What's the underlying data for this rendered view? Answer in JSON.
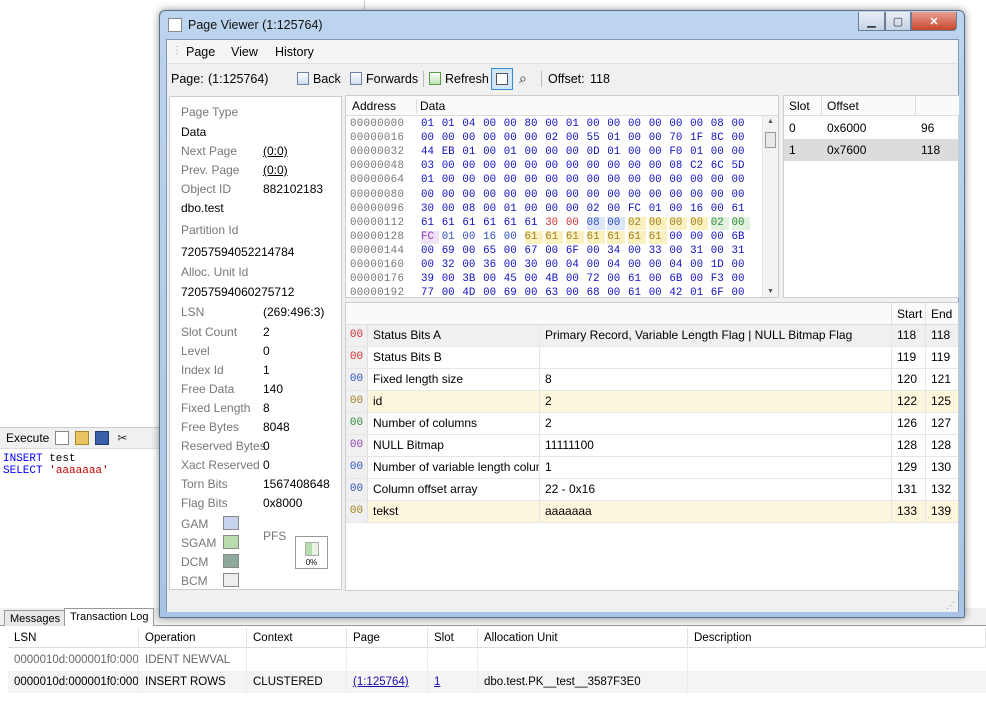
{
  "background": {
    "exec_label": "Execute",
    "sql_lines": [
      {
        "kw": "INSERT",
        "rest": " test",
        "str": ""
      },
      {
        "kw": "SELECT",
        "rest": " ",
        "str": "'aaaaaaa'"
      }
    ],
    "tabs": {
      "messages": "Messages",
      "transaction_log": "Transaction Log"
    },
    "log_columns": [
      "LSN",
      "Operation",
      "Context",
      "Page",
      "Slot",
      "Allocation Unit",
      "Description"
    ],
    "log_rows": [
      {
        "lsn": "0000010d:000001f0:0001",
        "op": "IDENT NEWVAL",
        "ctx": "",
        "page": "",
        "slot": "",
        "alloc": "",
        "desc": ""
      },
      {
        "lsn": "0000010d:000001f0:0003",
        "op": "INSERT ROWS",
        "ctx": "CLUSTERED",
        "page": "(1:125764)",
        "slot": "1",
        "alloc": "dbo.test.PK__test__3587F3E0",
        "desc": ""
      }
    ]
  },
  "window": {
    "title": "Page Viewer (1:125764)",
    "menu": [
      "Page",
      "View",
      "History"
    ],
    "toolbar": {
      "page_label": "Page:",
      "page_value": "(1:125764)",
      "back": "Back",
      "forwards": "Forwards",
      "refresh": "Refresh",
      "offset_label": "Offset:",
      "offset_value": "118"
    }
  },
  "info": {
    "page_type_label": "Page Type",
    "page_type": "Data",
    "next_page_label": "Next Page",
    "next_page": "(0:0)",
    "prev_page_label": "Prev. Page",
    "prev_page": "(0:0)",
    "object_id_label": "Object ID",
    "object_id": "882102183",
    "object_name": "dbo.test",
    "partition_id_label": "Partition Id",
    "partition_id": "72057594052214784",
    "alloc_unit_label": "Alloc. Unit Id",
    "alloc_unit_id": "72057594060275712",
    "lsn_label": "LSN",
    "lsn": "(269:496:3)",
    "slot_count_label": "Slot Count",
    "slot_count": "2",
    "level_label": "Level",
    "level": "0",
    "index_id_label": "Index Id",
    "index_id": "1",
    "free_data_label": "Free Data",
    "free_data": "140",
    "fixed_length_label": "Fixed Length",
    "fixed_length": "8",
    "free_bytes_label": "Free Bytes",
    "free_bytes": "8048",
    "reserved_bytes_label": "Reserved Bytes",
    "reserved_bytes": "0",
    "xact_reserved_label": "Xact Reserved",
    "xact_reserved": "0",
    "torn_bits_label": "Torn Bits",
    "torn_bits": "1567408648",
    "flag_bits_label": "Flag Bits",
    "flag_bits": "0x8000",
    "gam_label": "GAM",
    "sgam_label": "SGAM",
    "dcm_label": "DCM",
    "bcm_label": "BCM",
    "pfs_label": "PFS",
    "pfs_pct": "0%",
    "colors": {
      "gam": "#c8d4ee",
      "sgam": "#b9dcae",
      "dcm": "#8fa89c",
      "bcm": "#eeeeee"
    }
  },
  "hex": {
    "address_header": "Address",
    "data_header": "Data",
    "addresses": [
      "00000000",
      "00000016",
      "00000032",
      "00000048",
      "00000064",
      "00000080",
      "00000096",
      "00000112",
      "00000128",
      "00000144",
      "00000160",
      "00000176",
      "00000192"
    ],
    "rows": [
      "01 01 04 00 00 80 00 01 00 00 00 00 00 00 08 00",
      "00 00 00 00 00 00 02 00 55 01 00 00 70 1F 8C 00",
      "44 EB 01 00 01 00 00 00 0D 01 00 00 F0 01 00 00",
      "03 00 00 00 00 00 00 00 00 00 00 00 08 C2 6C 5D",
      "01 00 00 00 00 00 00 00 00 00 00 00 00 00 00 00",
      "00 00 00 00 00 00 00 00 00 00 00 00 00 00 00 00",
      "30 00 08 00 01 00 00 00 02 00 FC 01 00 16 00 61",
      "61 61 61 61 61 61 30 00 08 00 02 00 00 00 02 00",
      "FC 01 00 16 00 61 61 61 61 61 61 61 00 00 00 6B",
      "00 69 00 65 00 67 00 6F 00 34 00 33 00 31 00 31",
      "00 32 00 36 00 30 00 04 00 04 00 00 04 00 1D 00",
      "39 00 3B 00 45 00 4B 00 72 00 61 00 6B 00 F3 00",
      "77 00 4D 00 69 00 63 00 68 00 61 00 42 01 6F 00"
    ]
  },
  "slots": {
    "headers": [
      "Slot",
      "Offset"
    ],
    "rows": [
      {
        "slot": "0",
        "hex": "0x6000",
        "dec": "96"
      },
      {
        "slot": "1",
        "hex": "0x7600",
        "dec": "118"
      }
    ]
  },
  "fields": {
    "headers": {
      "start": "Start",
      "end": "End"
    },
    "rows": [
      {
        "code": "00",
        "code_color": "#d03030",
        "name": "Status Bits A",
        "value": "Primary Record, Variable Length Flag | NULL Bitmap Flag",
        "start": "118",
        "end": "118",
        "bg": "#f0f0f0"
      },
      {
        "code": "00",
        "code_color": "#d03030",
        "name": "Status Bits B",
        "value": "",
        "start": "119",
        "end": "119",
        "bg": "#ffffff"
      },
      {
        "code": "00",
        "code_color": "#3050c0",
        "name": "Fixed length size",
        "value": "8",
        "start": "120",
        "end": "121",
        "bg": "#ffffff"
      },
      {
        "code": "00",
        "code_color": "#a08020",
        "name": "id",
        "value": "2",
        "start": "122",
        "end": "125",
        "bg": "#fbf6dc"
      },
      {
        "code": "00",
        "code_color": "#2f8a3a",
        "name": "Number of columns",
        "value": "2",
        "start": "126",
        "end": "127",
        "bg": "#ffffff"
      },
      {
        "code": "00",
        "code_color": "#9040b0",
        "name": "NULL Bitmap",
        "value": "11111100",
        "start": "128",
        "end": "128",
        "bg": "#ffffff"
      },
      {
        "code": "00",
        "code_color": "#3050c0",
        "name": "Number of variable length columns",
        "value": "1",
        "start": "129",
        "end": "130",
        "bg": "#ffffff"
      },
      {
        "code": "00",
        "code_color": "#3050c0",
        "name": "Column offset array",
        "value": "22 - 0x16",
        "start": "131",
        "end": "132",
        "bg": "#ffffff"
      },
      {
        "code": "00",
        "code_color": "#a08020",
        "name": "tekst",
        "value": "aaaaaaa",
        "start": "133",
        "end": "139",
        "bg": "#fbf6dc"
      }
    ]
  }
}
